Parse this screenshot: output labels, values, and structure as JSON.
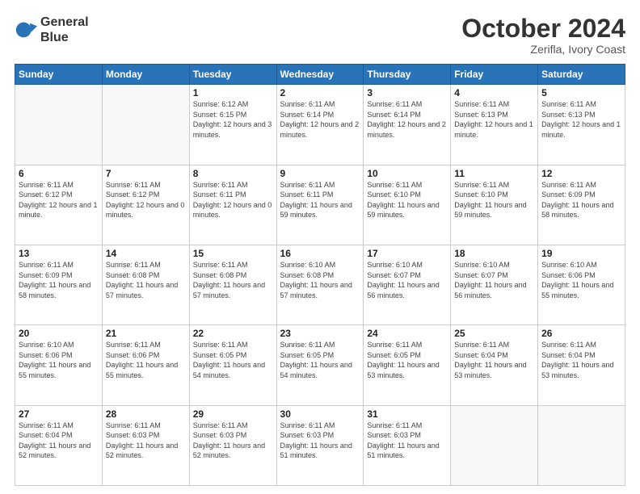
{
  "header": {
    "logo_line1": "General",
    "logo_line2": "Blue",
    "title": "October 2024",
    "subtitle": "Zerifla, Ivory Coast"
  },
  "weekdays": [
    "Sunday",
    "Monday",
    "Tuesday",
    "Wednesday",
    "Thursday",
    "Friday",
    "Saturday"
  ],
  "weeks": [
    [
      {
        "day": "",
        "sunrise": "",
        "sunset": "",
        "daylight": "",
        "empty": true
      },
      {
        "day": "",
        "sunrise": "",
        "sunset": "",
        "daylight": "",
        "empty": true
      },
      {
        "day": "1",
        "sunrise": "Sunrise: 6:12 AM",
        "sunset": "Sunset: 6:15 PM",
        "daylight": "Daylight: 12 hours and 3 minutes."
      },
      {
        "day": "2",
        "sunrise": "Sunrise: 6:11 AM",
        "sunset": "Sunset: 6:14 PM",
        "daylight": "Daylight: 12 hours and 2 minutes."
      },
      {
        "day": "3",
        "sunrise": "Sunrise: 6:11 AM",
        "sunset": "Sunset: 6:14 PM",
        "daylight": "Daylight: 12 hours and 2 minutes."
      },
      {
        "day": "4",
        "sunrise": "Sunrise: 6:11 AM",
        "sunset": "Sunset: 6:13 PM",
        "daylight": "Daylight: 12 hours and 1 minute."
      },
      {
        "day": "5",
        "sunrise": "Sunrise: 6:11 AM",
        "sunset": "Sunset: 6:13 PM",
        "daylight": "Daylight: 12 hours and 1 minute."
      }
    ],
    [
      {
        "day": "6",
        "sunrise": "Sunrise: 6:11 AM",
        "sunset": "Sunset: 6:12 PM",
        "daylight": "Daylight: 12 hours and 1 minute."
      },
      {
        "day": "7",
        "sunrise": "Sunrise: 6:11 AM",
        "sunset": "Sunset: 6:12 PM",
        "daylight": "Daylight: 12 hours and 0 minutes."
      },
      {
        "day": "8",
        "sunrise": "Sunrise: 6:11 AM",
        "sunset": "Sunset: 6:11 PM",
        "daylight": "Daylight: 12 hours and 0 minutes."
      },
      {
        "day": "9",
        "sunrise": "Sunrise: 6:11 AM",
        "sunset": "Sunset: 6:11 PM",
        "daylight": "Daylight: 11 hours and 59 minutes."
      },
      {
        "day": "10",
        "sunrise": "Sunrise: 6:11 AM",
        "sunset": "Sunset: 6:10 PM",
        "daylight": "Daylight: 11 hours and 59 minutes."
      },
      {
        "day": "11",
        "sunrise": "Sunrise: 6:11 AM",
        "sunset": "Sunset: 6:10 PM",
        "daylight": "Daylight: 11 hours and 59 minutes."
      },
      {
        "day": "12",
        "sunrise": "Sunrise: 6:11 AM",
        "sunset": "Sunset: 6:09 PM",
        "daylight": "Daylight: 11 hours and 58 minutes."
      }
    ],
    [
      {
        "day": "13",
        "sunrise": "Sunrise: 6:11 AM",
        "sunset": "Sunset: 6:09 PM",
        "daylight": "Daylight: 11 hours and 58 minutes."
      },
      {
        "day": "14",
        "sunrise": "Sunrise: 6:11 AM",
        "sunset": "Sunset: 6:08 PM",
        "daylight": "Daylight: 11 hours and 57 minutes."
      },
      {
        "day": "15",
        "sunrise": "Sunrise: 6:11 AM",
        "sunset": "Sunset: 6:08 PM",
        "daylight": "Daylight: 11 hours and 57 minutes."
      },
      {
        "day": "16",
        "sunrise": "Sunrise: 6:10 AM",
        "sunset": "Sunset: 6:08 PM",
        "daylight": "Daylight: 11 hours and 57 minutes."
      },
      {
        "day": "17",
        "sunrise": "Sunrise: 6:10 AM",
        "sunset": "Sunset: 6:07 PM",
        "daylight": "Daylight: 11 hours and 56 minutes."
      },
      {
        "day": "18",
        "sunrise": "Sunrise: 6:10 AM",
        "sunset": "Sunset: 6:07 PM",
        "daylight": "Daylight: 11 hours and 56 minutes."
      },
      {
        "day": "19",
        "sunrise": "Sunrise: 6:10 AM",
        "sunset": "Sunset: 6:06 PM",
        "daylight": "Daylight: 11 hours and 55 minutes."
      }
    ],
    [
      {
        "day": "20",
        "sunrise": "Sunrise: 6:10 AM",
        "sunset": "Sunset: 6:06 PM",
        "daylight": "Daylight: 11 hours and 55 minutes."
      },
      {
        "day": "21",
        "sunrise": "Sunrise: 6:11 AM",
        "sunset": "Sunset: 6:06 PM",
        "daylight": "Daylight: 11 hours and 55 minutes."
      },
      {
        "day": "22",
        "sunrise": "Sunrise: 6:11 AM",
        "sunset": "Sunset: 6:05 PM",
        "daylight": "Daylight: 11 hours and 54 minutes."
      },
      {
        "day": "23",
        "sunrise": "Sunrise: 6:11 AM",
        "sunset": "Sunset: 6:05 PM",
        "daylight": "Daylight: 11 hours and 54 minutes."
      },
      {
        "day": "24",
        "sunrise": "Sunrise: 6:11 AM",
        "sunset": "Sunset: 6:05 PM",
        "daylight": "Daylight: 11 hours and 53 minutes."
      },
      {
        "day": "25",
        "sunrise": "Sunrise: 6:11 AM",
        "sunset": "Sunset: 6:04 PM",
        "daylight": "Daylight: 11 hours and 53 minutes."
      },
      {
        "day": "26",
        "sunrise": "Sunrise: 6:11 AM",
        "sunset": "Sunset: 6:04 PM",
        "daylight": "Daylight: 11 hours and 53 minutes."
      }
    ],
    [
      {
        "day": "27",
        "sunrise": "Sunrise: 6:11 AM",
        "sunset": "Sunset: 6:04 PM",
        "daylight": "Daylight: 11 hours and 52 minutes."
      },
      {
        "day": "28",
        "sunrise": "Sunrise: 6:11 AM",
        "sunset": "Sunset: 6:03 PM",
        "daylight": "Daylight: 11 hours and 52 minutes."
      },
      {
        "day": "29",
        "sunrise": "Sunrise: 6:11 AM",
        "sunset": "Sunset: 6:03 PM",
        "daylight": "Daylight: 11 hours and 52 minutes."
      },
      {
        "day": "30",
        "sunrise": "Sunrise: 6:11 AM",
        "sunset": "Sunset: 6:03 PM",
        "daylight": "Daylight: 11 hours and 51 minutes."
      },
      {
        "day": "31",
        "sunrise": "Sunrise: 6:11 AM",
        "sunset": "Sunset: 6:03 PM",
        "daylight": "Daylight: 11 hours and 51 minutes."
      },
      {
        "day": "",
        "sunrise": "",
        "sunset": "",
        "daylight": "",
        "empty": true
      },
      {
        "day": "",
        "sunrise": "",
        "sunset": "",
        "daylight": "",
        "empty": true
      }
    ]
  ]
}
